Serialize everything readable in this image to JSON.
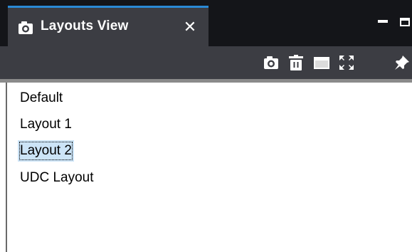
{
  "window": {
    "tab_title": "Layouts View",
    "tab_close_glyph": "✕",
    "tab_icon": "camera-icon",
    "accent_color": "#2a8ad6"
  },
  "toolbar": {
    "buttons": [
      {
        "name": "camera-button",
        "icon": "camera-icon"
      },
      {
        "name": "delete-button",
        "icon": "trash-icon"
      },
      {
        "name": "window-button",
        "icon": "window-icon"
      },
      {
        "name": "fullscreen-button",
        "icon": "expand-icon"
      },
      {
        "name": "pin-button",
        "icon": "pin-icon"
      }
    ]
  },
  "layouts": {
    "items": [
      {
        "label": "Default"
      },
      {
        "label": "Layout 1"
      },
      {
        "label": "Layout 2",
        "selected": true
      },
      {
        "label": "UDC Layout"
      }
    ]
  }
}
